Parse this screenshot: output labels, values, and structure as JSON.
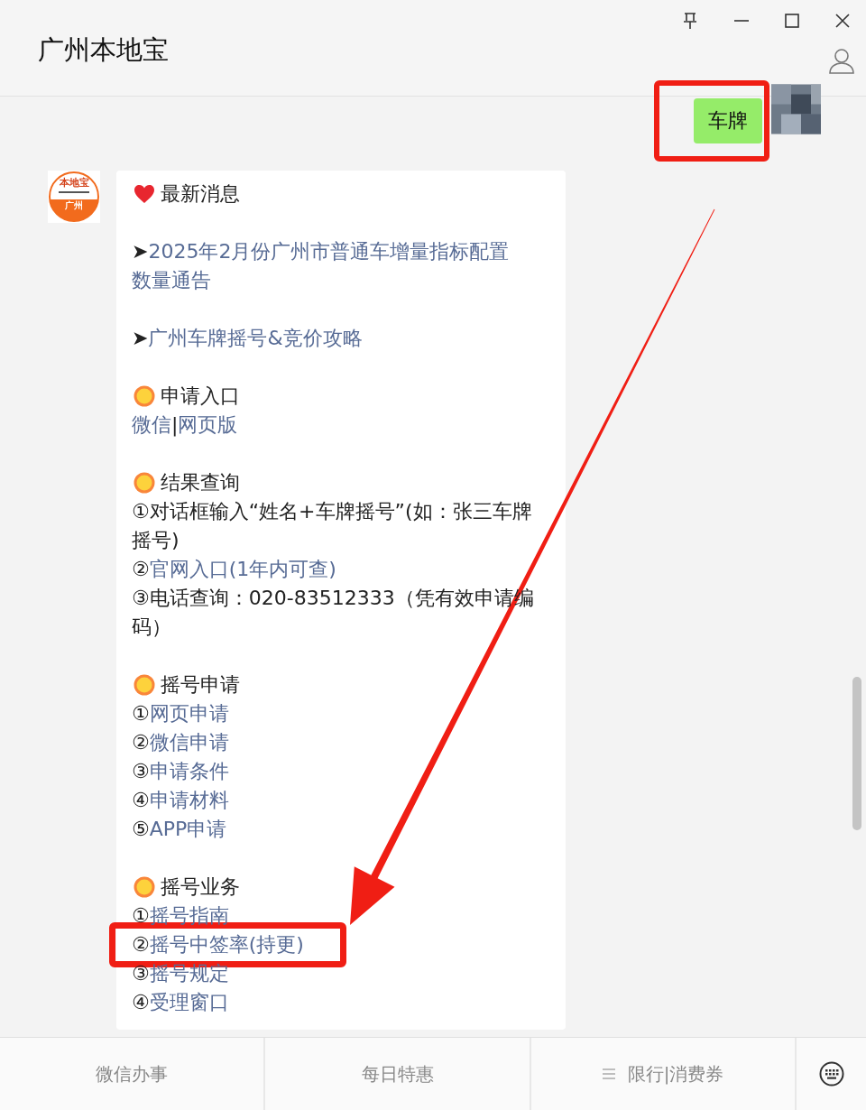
{
  "window": {
    "title": "广州本地宝"
  },
  "outgoing": {
    "text": "车牌",
    "highlighted": true
  },
  "incoming": {
    "avatar_texts": [
      "本地宝",
      "广州"
    ],
    "sections": [
      {
        "lines": [
          {
            "kind": "heading",
            "text": "最新消息"
          }
        ]
      },
      {
        "lines": [
          {
            "kind": "body",
            "highlighted": false,
            "segments": [
              {
                "text": "➤",
                "link": false
              },
              {
                "text": "2025年2月份广州市普通车增量指标配置",
                "link": true
              }
            ]
          },
          {
            "kind": "body",
            "highlighted": false,
            "segments": [
              {
                "text": "数量通告",
                "link": true
              }
            ]
          }
        ]
      },
      {
        "lines": [
          {
            "kind": "body",
            "highlighted": false,
            "segments": [
              {
                "text": "➤",
                "link": false
              },
              {
                "text": "广州车牌摇号&竞价攻略",
                "link": true
              }
            ]
          }
        ]
      },
      {
        "lines": [
          {
            "kind": "heading",
            "text": "申请入口"
          },
          {
            "kind": "body",
            "highlighted": false,
            "segments": [
              {
                "text": "微信",
                "link": true
              },
              {
                "text": "|",
                "link": false
              },
              {
                "text": "网页版",
                "link": true
              }
            ]
          }
        ]
      },
      {
        "lines": [
          {
            "kind": "heading",
            "text": "结果查询"
          },
          {
            "kind": "body",
            "highlighted": false,
            "segments": [
              {
                "text": "①对话框输入“姓名+车牌摇号”(如：张三车牌摇号)",
                "link": false
              }
            ]
          },
          {
            "kind": "body",
            "highlighted": false,
            "segments": [
              {
                "text": "②",
                "link": false
              },
              {
                "text": "官网入口(1年内可查)",
                "link": true
              }
            ]
          },
          {
            "kind": "body",
            "highlighted": false,
            "segments": [
              {
                "text": "③电话查询：020-83512333（凭有效申请编码）",
                "link": false
              }
            ]
          }
        ]
      },
      {
        "lines": [
          {
            "kind": "heading",
            "text": "摇号申请"
          },
          {
            "kind": "body",
            "highlighted": false,
            "segments": [
              {
                "text": "①",
                "link": false
              },
              {
                "text": "网页申请",
                "link": true
              }
            ]
          },
          {
            "kind": "body",
            "highlighted": false,
            "segments": [
              {
                "text": "②",
                "link": false
              },
              {
                "text": "微信申请",
                "link": true
              }
            ]
          },
          {
            "kind": "body",
            "highlighted": false,
            "segments": [
              {
                "text": "③",
                "link": false
              },
              {
                "text": "申请条件",
                "link": true
              }
            ]
          },
          {
            "kind": "body",
            "highlighted": false,
            "segments": [
              {
                "text": "④",
                "link": false
              },
              {
                "text": "申请材料",
                "link": true
              }
            ]
          },
          {
            "kind": "body",
            "highlighted": false,
            "segments": [
              {
                "text": "⑤",
                "link": false
              },
              {
                "text": "APP申请",
                "link": true
              }
            ]
          }
        ]
      },
      {
        "lines": [
          {
            "kind": "heading",
            "text": "摇号业务"
          },
          {
            "kind": "body",
            "highlighted": false,
            "segments": [
              {
                "text": "①",
                "link": false
              },
              {
                "text": "摇号指南",
                "link": true
              }
            ]
          },
          {
            "kind": "body",
            "highlighted": true,
            "segments": [
              {
                "text": "②",
                "link": false
              },
              {
                "text": "摇号中签率(持更)",
                "link": true
              }
            ]
          },
          {
            "kind": "body",
            "highlighted": false,
            "segments": [
              {
                "text": "③",
                "link": false
              },
              {
                "text": "摇号规定",
                "link": true
              }
            ]
          },
          {
            "kind": "body",
            "highlighted": false,
            "segments": [
              {
                "text": "④",
                "link": false
              },
              {
                "text": "受理窗口",
                "link": true
              }
            ]
          }
        ]
      }
    ]
  },
  "annotation_arrow": true,
  "menu": [
    {
      "label": "微信办事",
      "has_icon": false
    },
    {
      "label": "每日特惠",
      "has_icon": false
    },
    {
      "label": "限行|消费券",
      "has_icon": true
    }
  ]
}
